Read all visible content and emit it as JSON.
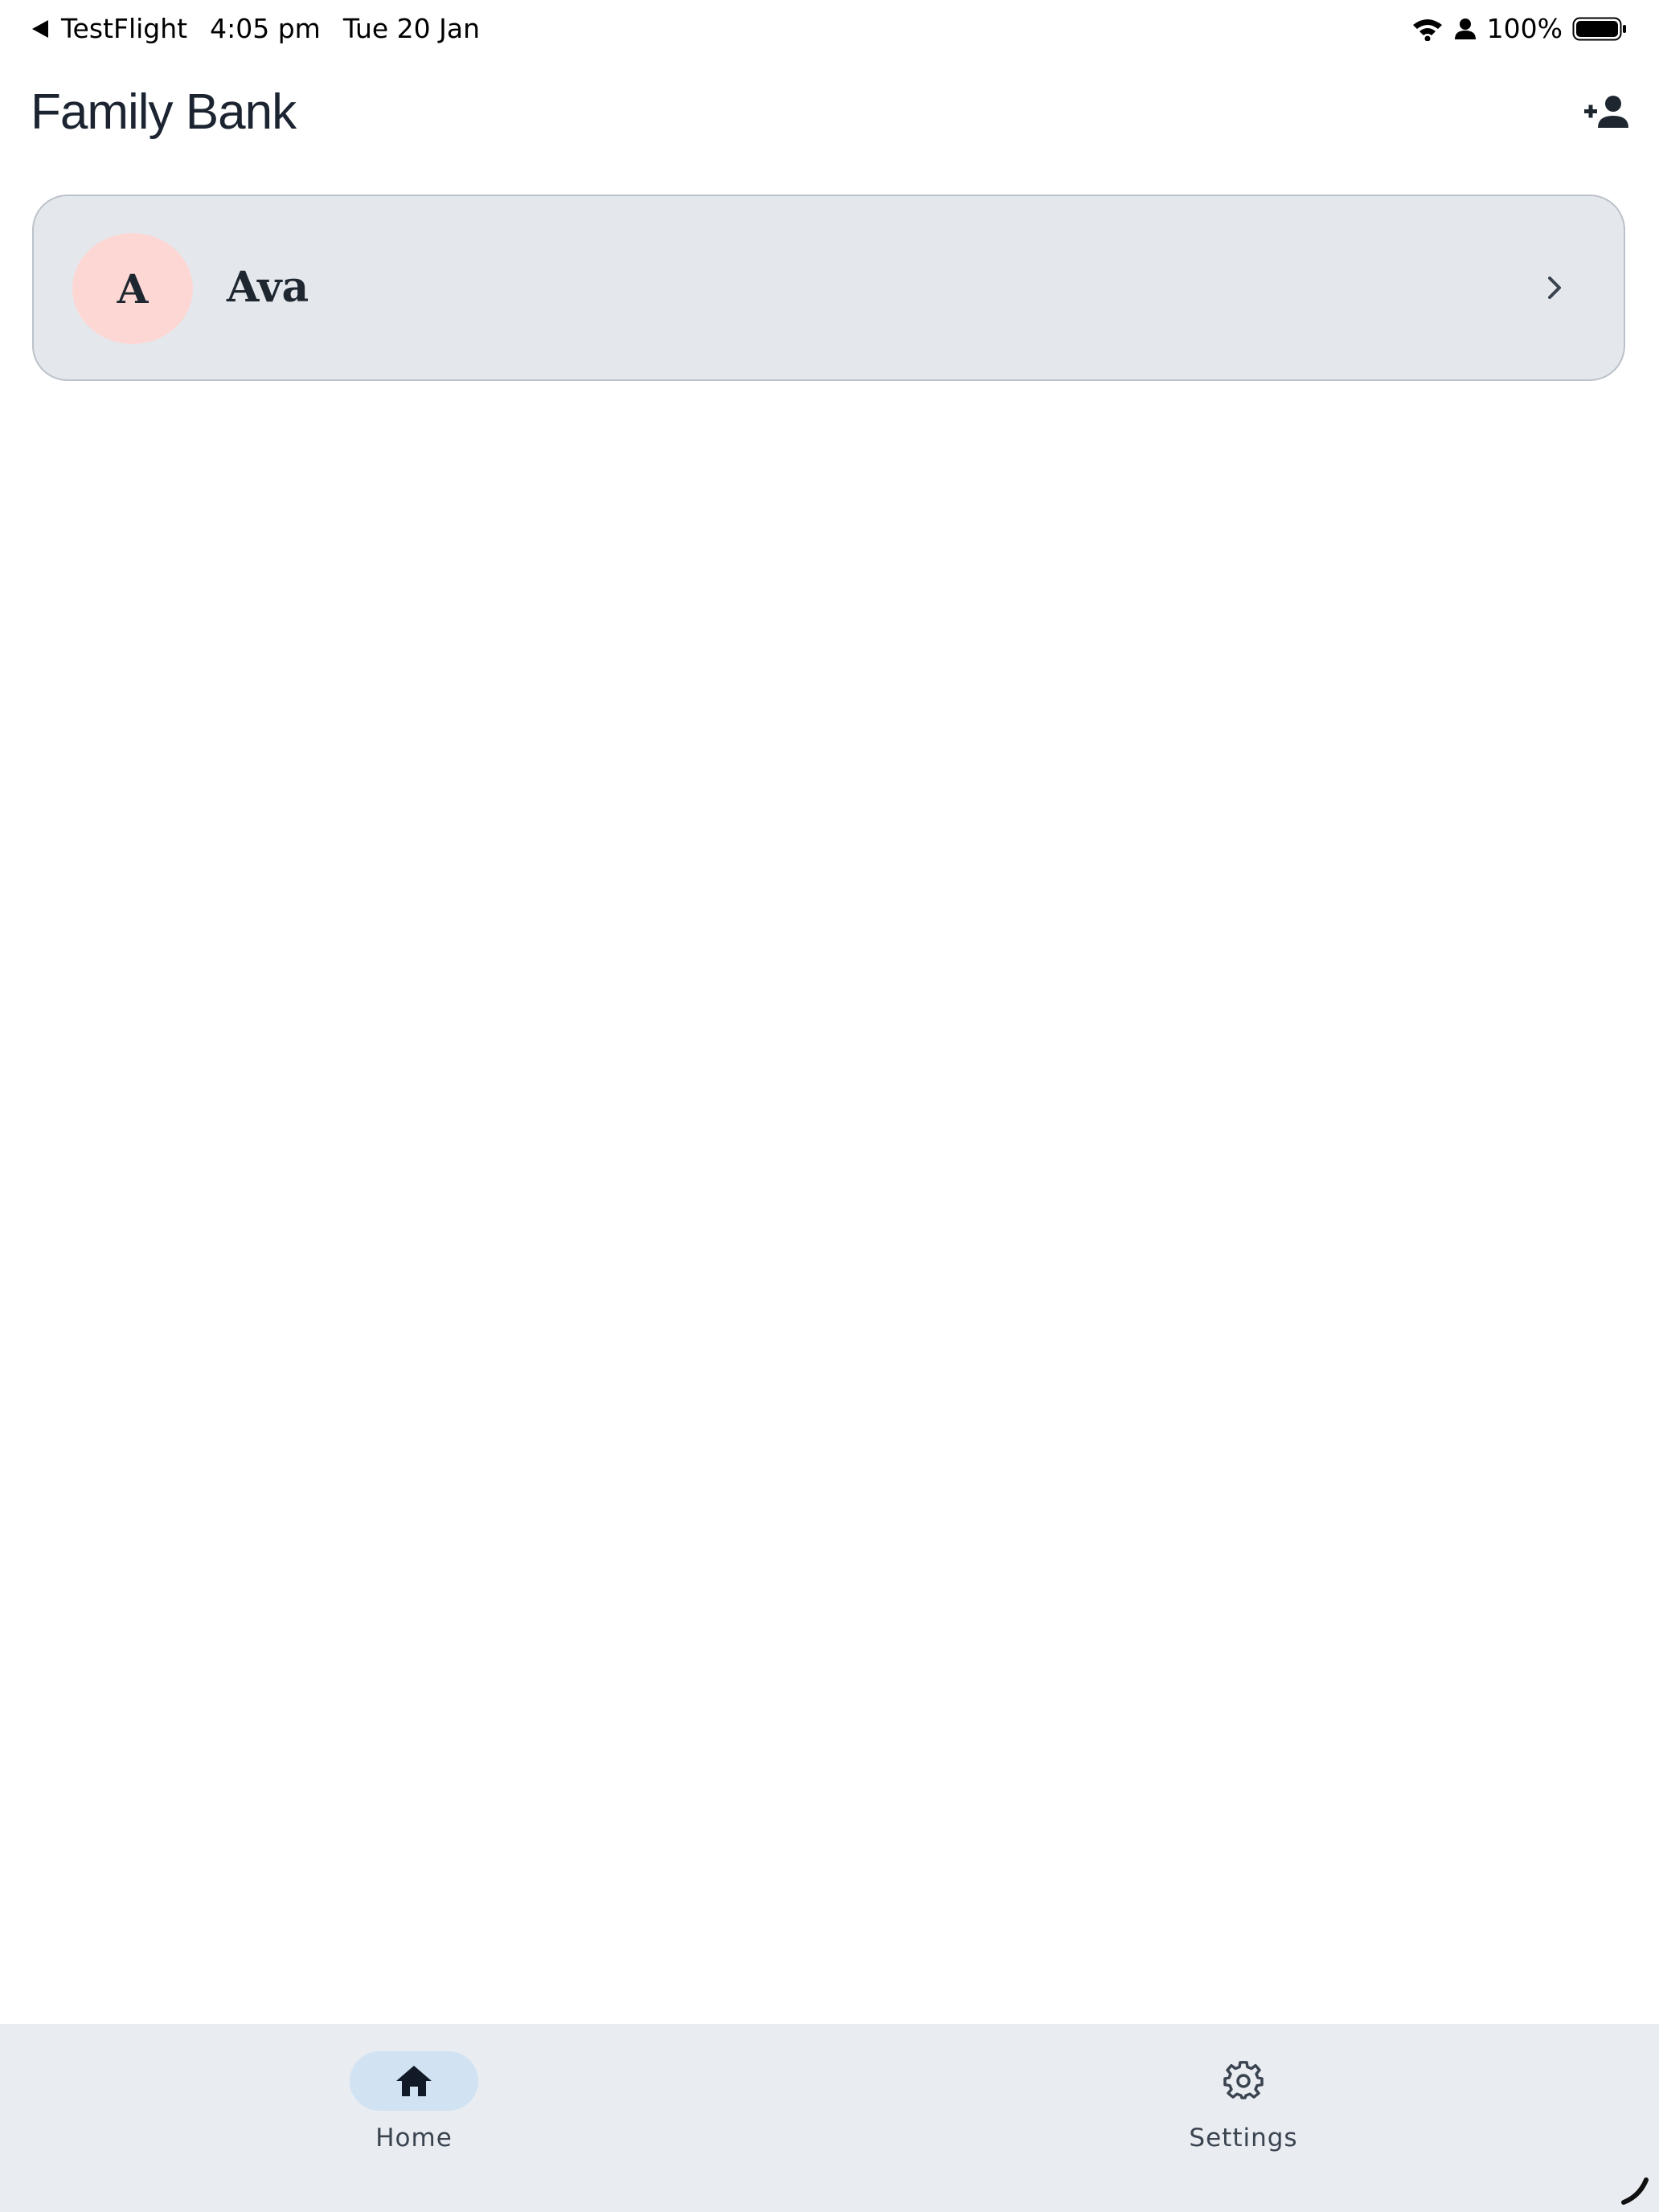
{
  "status_bar": {
    "back_app": "TestFlight",
    "time": "4:05 pm",
    "date": "Tue 20 Jan",
    "battery": "100%",
    "icons": [
      "back-arrow-icon",
      "wifi-icon",
      "person-icon",
      "battery-icon"
    ]
  },
  "header": {
    "title": "Family Bank",
    "add_icon": "person-add-icon"
  },
  "children": [
    {
      "initial": "A",
      "name": "Ava",
      "avatar_color": "#fdd7d3",
      "icon": "chevron-right-icon"
    }
  ],
  "bottom_nav": {
    "items": [
      {
        "label": "Home",
        "icon": "home-icon",
        "active": true
      },
      {
        "label": "Settings",
        "icon": "gear-icon",
        "active": false
      }
    ],
    "active_color": "#d1e2f3",
    "background": "#e9ecf0"
  },
  "colors": {
    "card_background": "#e4e8ed",
    "card_border": "#bcc2ca",
    "text": "#1b2430"
  }
}
